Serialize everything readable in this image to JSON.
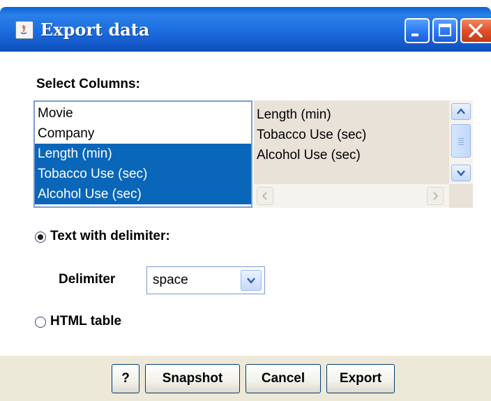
{
  "window": {
    "title": "Export data",
    "controls": [
      "minimize-icon",
      "maximize-icon",
      "close-icon"
    ]
  },
  "columns_section": {
    "label": "Select Columns:",
    "available": [
      {
        "label": "Movie",
        "selected": false
      },
      {
        "label": "Company",
        "selected": false
      },
      {
        "label": "Length (min)",
        "selected": true
      },
      {
        "label": "Tobacco Use (sec)",
        "selected": true
      },
      {
        "label": "Alcohol Use (sec)",
        "selected": true
      }
    ],
    "chosen": [
      "Length (min)",
      "Tobacco Use (sec)",
      "Alcohol Use (sec)"
    ]
  },
  "format": {
    "text_option": {
      "label": "Text with delimiter:",
      "checked": true
    },
    "delimiter_label": "Delimiter",
    "delimiter_value": "space",
    "html_option": {
      "label": "HTML table",
      "checked": false
    }
  },
  "buttons": {
    "help": "?",
    "snapshot": "Snapshot",
    "cancel": "Cancel",
    "export": "Export"
  },
  "colors": {
    "titlebar": "#1e6fe0",
    "selection": "#0a66b8",
    "button_bar": "#ece9d8",
    "right_list_bg": "#e8e2d8"
  }
}
